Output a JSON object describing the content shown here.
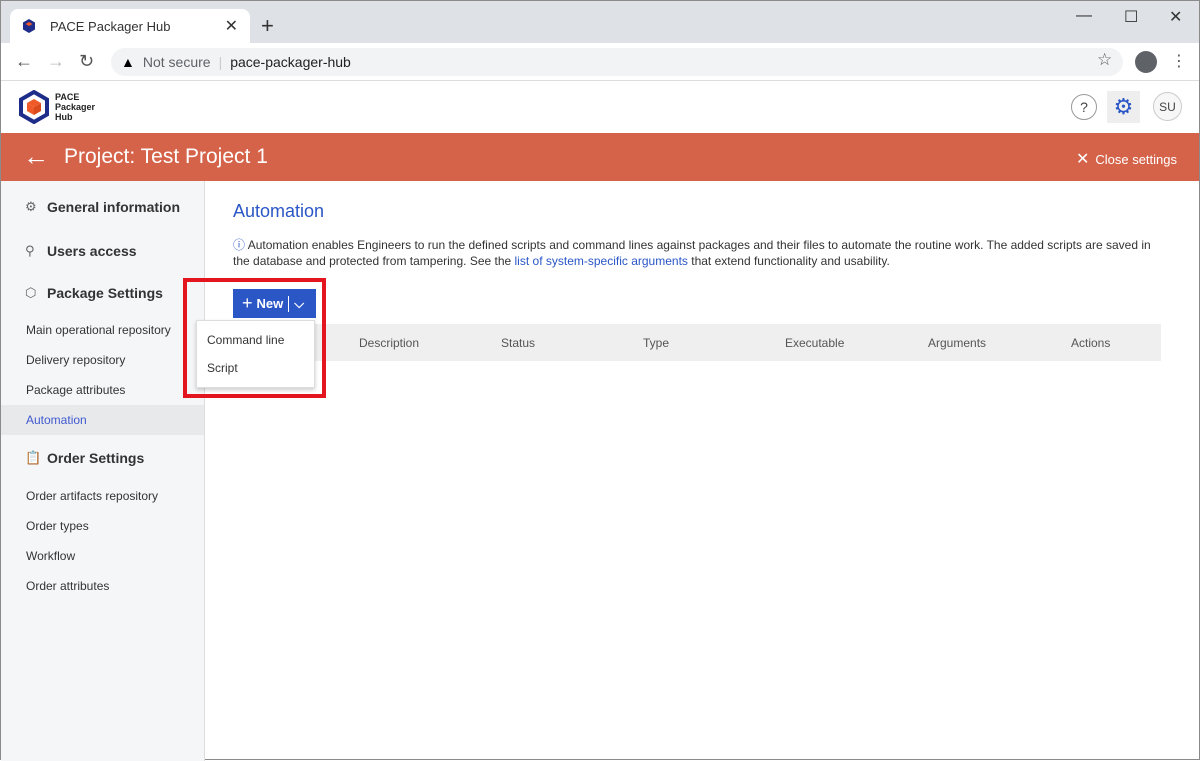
{
  "browser": {
    "tab_title": "PACE Packager Hub",
    "security": "Not secure",
    "url": "pace-packager-hub"
  },
  "app": {
    "logo_text": [
      "PACE",
      "Packager",
      "Hub"
    ],
    "help": "?",
    "user_initials": "SU"
  },
  "banner": {
    "title": "Project: Test Project 1",
    "close_label": "Close settings"
  },
  "sidebar": {
    "general": "General information",
    "users": "Users access",
    "package_settings": "Package Settings",
    "package_items": [
      "Main operational repository",
      "Delivery repository",
      "Package attributes",
      "Automation"
    ],
    "order_settings": "Order Settings",
    "order_items": [
      "Order artifacts repository",
      "Order types",
      "Workflow",
      "Order attributes"
    ]
  },
  "main": {
    "title": "Automation",
    "info_text": "Automation enables Engineers to run the defined scripts and command lines against packages and their files to automate the routine work. The added scripts are saved in the database and protected from tampering. See the ",
    "info_link": "list of system-specific arguments",
    "info_tail": " that extend functionality and usability.",
    "new_label": "New",
    "columns": [
      "Description",
      "Status",
      "Type",
      "Executable",
      "Arguments",
      "Actions"
    ],
    "dropdown": [
      "Command line",
      "Script"
    ]
  },
  "colors": {
    "accent": "#2a56c6",
    "banner": "#d5634a",
    "highlight": "#e3161f"
  }
}
